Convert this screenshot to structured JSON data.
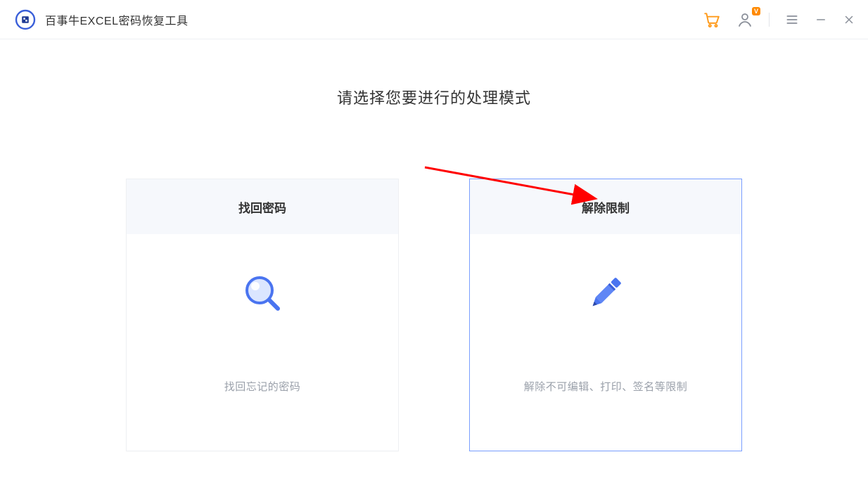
{
  "app": {
    "title": "百事牛EXCEL密码恢复工具"
  },
  "header": {
    "cart_icon": "cart-icon",
    "account_icon": "account-icon",
    "vip_badge": "V",
    "menu_icon": "menu-icon",
    "minimize_icon": "minimize-icon",
    "close_icon": "close-icon"
  },
  "main": {
    "heading": "请选择您要进行的处理模式",
    "cards": [
      {
        "title": "找回密码",
        "desc": "找回忘记的密码",
        "icon": "magnifier-icon",
        "selected": false
      },
      {
        "title": "解除限制",
        "desc": "解除不可编辑、打印、签名等限制",
        "icon": "pencil-icon",
        "selected": true
      }
    ]
  },
  "colors": {
    "accent": "#4a74f0",
    "cart": "#ff9a1a",
    "border_selected": "#7a9fff"
  }
}
